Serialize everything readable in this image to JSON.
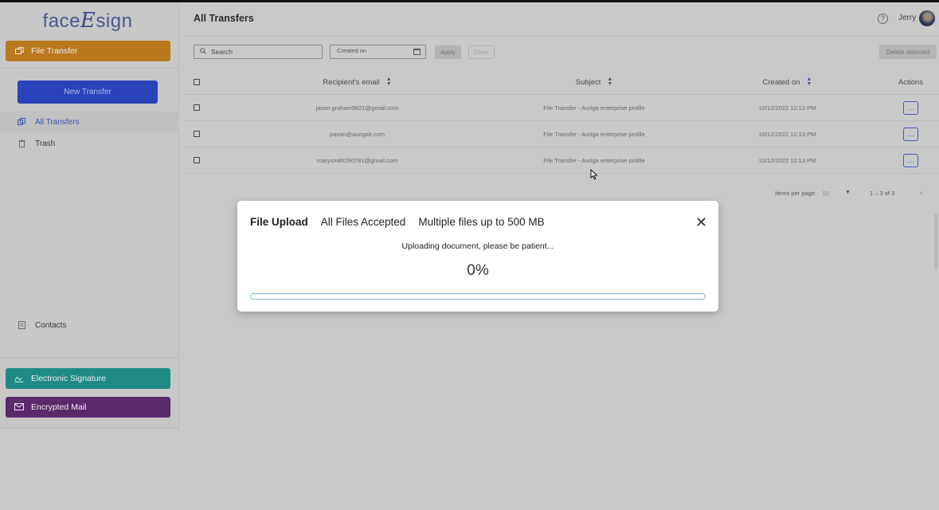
{
  "app": {
    "logo_prefix": "face",
    "logo_mark": "E",
    "logo_suffix": "sign"
  },
  "sidebar": {
    "file_transfer": "File Transfer",
    "new_transfer": "New Transfer",
    "nav": [
      {
        "label": "All Transfers",
        "icon": "transfers-icon",
        "active": true
      },
      {
        "label": "Trash",
        "icon": "trash-icon",
        "active": false
      }
    ],
    "contacts": "Contacts",
    "electronic_signature": "Electronic Signature",
    "encrypted_mail": "Encrypted Mail"
  },
  "header": {
    "title": "All Transfers",
    "user": "Jerry"
  },
  "toolbar": {
    "search_placeholder": "Search",
    "created_on_placeholder": "Created on",
    "apply": "Apply",
    "clear": "Clear",
    "delete_selected": "Delete selected"
  },
  "table": {
    "columns": {
      "email": "Recipient's email",
      "subject": "Subject",
      "created": "Created on",
      "actions": "Actions"
    },
    "rows": [
      {
        "email": "jason.graham9821@gmail.com",
        "subject": "File Transfer - Auriga enterprise profile",
        "created": "10/12/2022 12:13 PM"
      },
      {
        "email": "pavan@aurigait.com",
        "subject": "File Transfer - Auriga enterprise profile",
        "created": "10/12/2022 12:13 PM"
      },
      {
        "email": "marysmith290781@gmail.com",
        "subject": "File Transfer - Auriga enterprise profile",
        "created": "10/12/2022 12:13 PM"
      }
    ]
  },
  "pager": {
    "items_label": "Items per page:",
    "page_size": "10",
    "range": "1 – 3 of 3"
  },
  "modal": {
    "title": "File Upload",
    "accepted": "All Files Accepted",
    "limit": "Multiple files up to 500 MB",
    "message": "Uploading document, please be patient...",
    "percent": "0%",
    "progress_fraction": 0
  },
  "colors": {
    "file_transfer": "#b9781d",
    "electronic_signature": "#1f8a84",
    "encrypted_mail": "#5b2a6b",
    "primary": "#2b43b8"
  }
}
